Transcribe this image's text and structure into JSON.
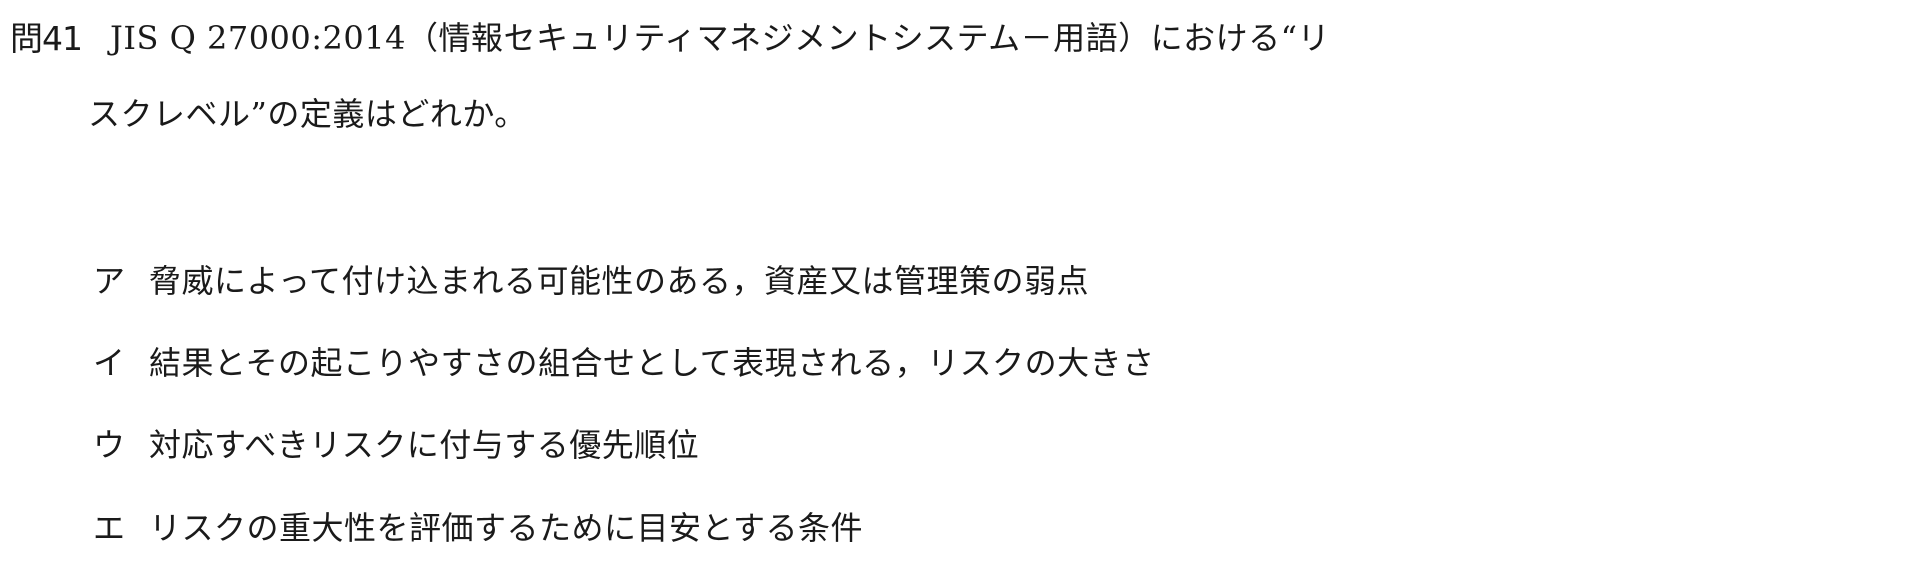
{
  "question": {
    "number": "問41",
    "text_line1": "JIS Q 27000:2014（情報セキュリティマネジメントシステム－用語）における“リ",
    "text_line2": "スクレベル”の定義はどれか。"
  },
  "choices": [
    {
      "label": "ア",
      "text": "脅威によって付け込まれる可能性のある，資産又は管理策の弱点"
    },
    {
      "label": "イ",
      "text": "結果とその起こりやすさの組合せとして表現される，リスクの大きさ"
    },
    {
      "label": "ウ",
      "text": "対応すべきリスクに付与する優先順位"
    },
    {
      "label": "エ",
      "text": "リスクの重大性を評価するために目安とする条件"
    }
  ]
}
